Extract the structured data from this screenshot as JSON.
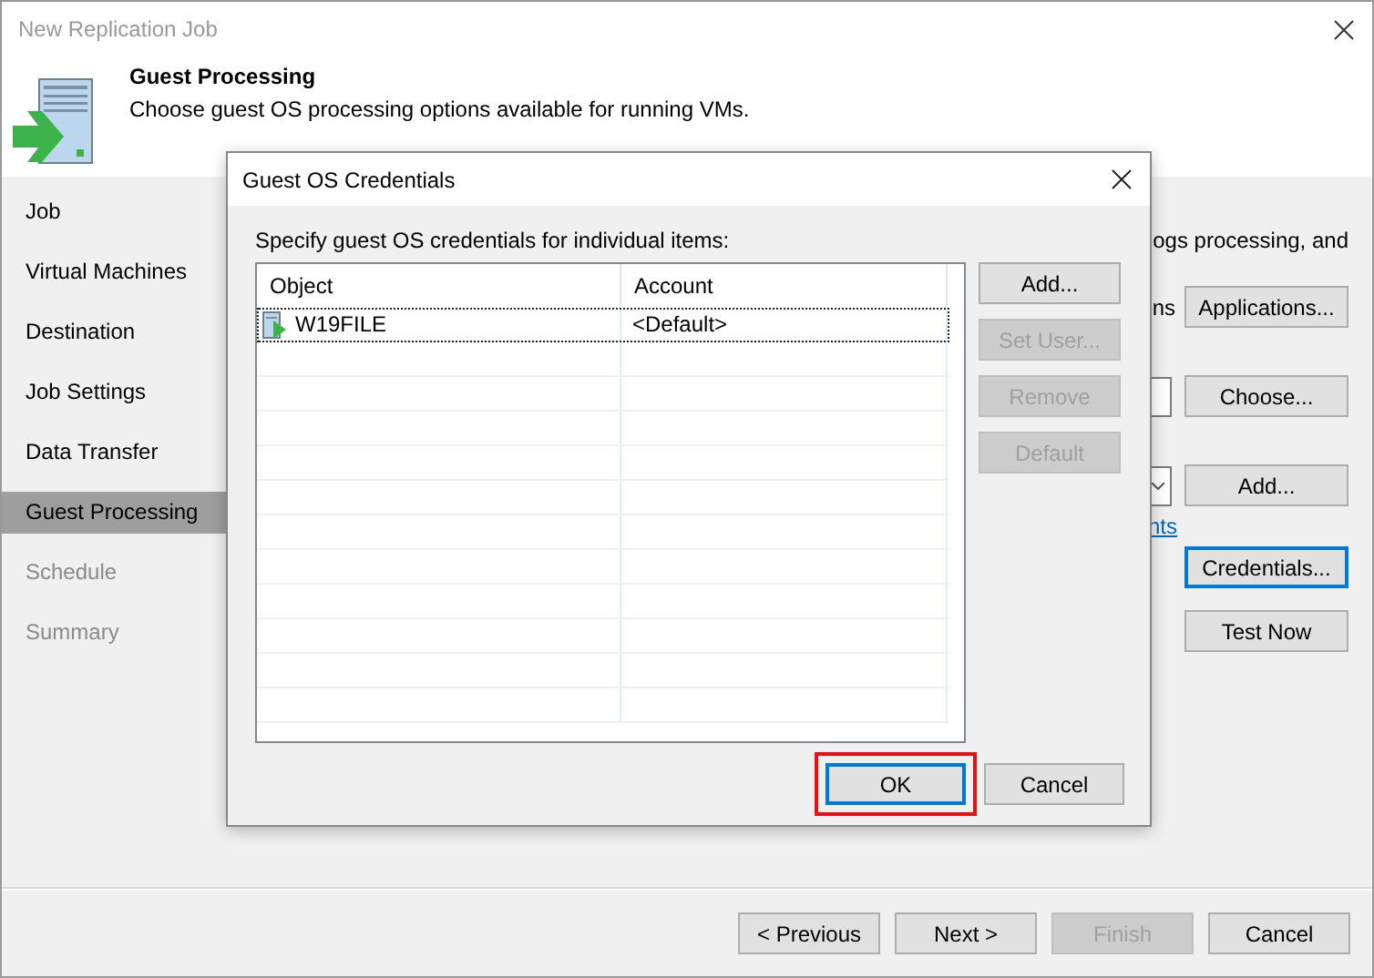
{
  "window": {
    "title": "New Replication Job"
  },
  "header": {
    "title": "Guest Processing",
    "subtitle": "Choose guest OS processing options available for running VMs."
  },
  "steps": [
    {
      "label": "Job",
      "selected": false,
      "disabled": false
    },
    {
      "label": "Virtual Machines",
      "selected": false,
      "disabled": false
    },
    {
      "label": "Destination",
      "selected": false,
      "disabled": false
    },
    {
      "label": "Job Settings",
      "selected": false,
      "disabled": false
    },
    {
      "label": "Data Transfer",
      "selected": false,
      "disabled": false
    },
    {
      "label": "Guest Processing",
      "selected": true,
      "disabled": false
    },
    {
      "label": "Schedule",
      "selected": false,
      "disabled": true
    },
    {
      "label": "Summary",
      "selected": false,
      "disabled": true
    }
  ],
  "page_rows": [
    {
      "kind": "text",
      "text": "ogs processing, and"
    },
    {
      "kind": "button",
      "text": "ns",
      "button": {
        "label": "Applications...",
        "focused": false
      }
    },
    {
      "kind": "field",
      "button": {
        "label": "Choose...",
        "focused": false
      }
    },
    {
      "kind": "dropdown",
      "button": {
        "label": "Add...",
        "focused": false
      }
    },
    {
      "kind": "link",
      "text": "nts"
    },
    {
      "kind": "button",
      "button": {
        "label": "Credentials...",
        "focused": true
      }
    },
    {
      "kind": "button",
      "button": {
        "label": "Test Now",
        "focused": false
      }
    }
  ],
  "dialog": {
    "title": "Guest OS Credentials",
    "label": "Specify guest OS credentials for individual items:",
    "columns": [
      "Object",
      "Account"
    ],
    "rows": [
      {
        "object": "W19FILE",
        "account": "<Default>",
        "selected": true
      }
    ],
    "side_buttons": [
      {
        "label": "Add...",
        "disabled": false
      },
      {
        "label": "Set User...",
        "disabled": true
      },
      {
        "label": "Remove",
        "disabled": true
      },
      {
        "label": "Default",
        "disabled": true
      }
    ],
    "buttons": [
      {
        "label": "OK",
        "default": true,
        "highlighted": true
      },
      {
        "label": "Cancel",
        "default": false,
        "highlighted": false
      }
    ]
  },
  "footer_buttons": [
    {
      "label": "< Previous",
      "disabled": false
    },
    {
      "label": "Next >",
      "disabled": false
    },
    {
      "label": "Finish",
      "disabled": true
    },
    {
      "label": "Cancel",
      "disabled": false
    }
  ]
}
